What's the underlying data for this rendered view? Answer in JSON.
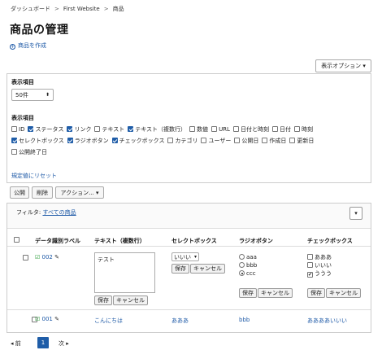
{
  "breadcrumb": [
    "ダッシュボード",
    "First Website",
    "商品"
  ],
  "breadcrumb_sep": ">",
  "page_title": "商品の管理",
  "create_link": "商品を作成",
  "display_options_button": "表示オプション ▾",
  "options_panel": {
    "per_page_label": "表示項目",
    "per_page_value": "50件",
    "columns_label": "表示項目",
    "columns": [
      {
        "label": "ID",
        "checked": false
      },
      {
        "label": "ステータス",
        "checked": true
      },
      {
        "label": "リンク",
        "checked": true
      },
      {
        "label": "テキスト",
        "checked": false
      },
      {
        "label": "テキスト（複数行）",
        "checked": true
      },
      {
        "label": "数値",
        "checked": false
      },
      {
        "label": "URL",
        "checked": false
      },
      {
        "label": "日付と時刻",
        "checked": false
      },
      {
        "label": "日付",
        "checked": false
      },
      {
        "label": "時刻",
        "checked": false
      },
      {
        "label": "セレクトボックス",
        "checked": true
      },
      {
        "label": "ラジオボタン",
        "checked": true
      },
      {
        "label": "チェックボックス",
        "checked": true
      },
      {
        "label": "カテゴリ",
        "checked": false
      },
      {
        "label": "ユーザー",
        "checked": false
      },
      {
        "label": "公開日",
        "checked": false
      },
      {
        "label": "作成日",
        "checked": false
      },
      {
        "label": "更新日",
        "checked": false
      },
      {
        "label": "公開終了日",
        "checked": false
      }
    ],
    "reset_link": "規定値にリセット"
  },
  "bulk_actions": {
    "publish": "公開",
    "delete": "削除",
    "actions": "アクション..."
  },
  "filter": {
    "label": "フィルタ:",
    "value": "すべての商品"
  },
  "table": {
    "headers": [
      "データ識別ラベル",
      "テキスト（複数行）",
      "セレクトボックス",
      "ラジオボタン",
      "チェックボックス"
    ],
    "rows": [
      {
        "id": "002",
        "textarea_value": "テスト",
        "select_value": "いいい",
        "radio_options": [
          {
            "label": "aaa",
            "checked": false
          },
          {
            "label": "bbb",
            "checked": false
          },
          {
            "label": "ccc",
            "checked": true
          }
        ],
        "checkbox_options": [
          {
            "label": "あああ",
            "checked": false
          },
          {
            "label": "いいい",
            "checked": false
          },
          {
            "label": "ううう",
            "checked": true
          }
        ]
      },
      {
        "id": "001",
        "text": "こんにちは",
        "select": "あああ",
        "radio": "bbb",
        "checkbox": "ああああいいい"
      }
    ],
    "save_label": "保存",
    "cancel_label": "キャンセル"
  },
  "pagination": {
    "prev": "前",
    "current": "1",
    "next": "次"
  },
  "colors": {
    "link": "#1c58a6",
    "accent": "#1f5da8",
    "success": "#2a9d3a"
  }
}
